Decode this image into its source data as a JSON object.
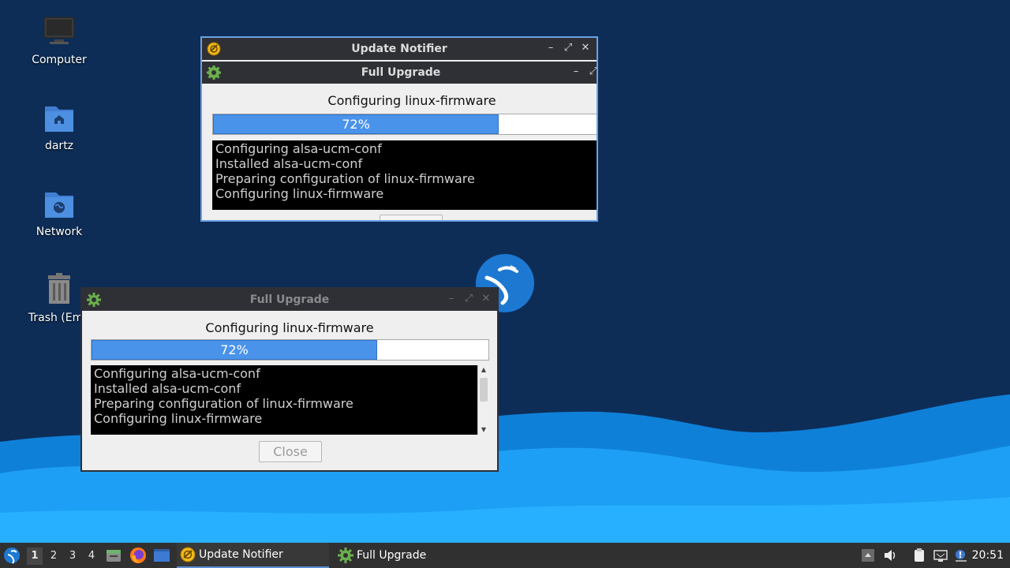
{
  "desktop": {
    "icons": [
      {
        "label": "Computer"
      },
      {
        "label": "dartz"
      },
      {
        "label": "Network"
      },
      {
        "label": "Trash (Emp"
      }
    ]
  },
  "update_notifier": {
    "title": "Update Notifier",
    "inner_title": "Full Upgrade",
    "status": "Configuring linux-firmware",
    "progress_percent": 72,
    "progress_label": "72%",
    "log": [
      "Configuring alsa-ucm-conf",
      "Installed alsa-ucm-conf",
      "Preparing configuration of linux-firmware",
      "Configuring linux-firmware"
    ]
  },
  "full_upgrade": {
    "title": "Full Upgrade",
    "status": "Configuring linux-firmware",
    "progress_percent": 72,
    "progress_label": "72%",
    "log": [
      "Configuring alsa-ucm-conf",
      "Installed alsa-ucm-conf",
      "Preparing configuration of linux-firmware",
      "Configuring linux-firmware"
    ],
    "close_label": "Close"
  },
  "taskbar": {
    "workspaces": [
      "1",
      "2",
      "3",
      "4"
    ],
    "current_workspace": "1",
    "tasks": [
      {
        "label": "Update Notifier",
        "icon": "update-notifier-icon",
        "active": true
      },
      {
        "label": "Full Upgrade",
        "icon": "gear-icon",
        "active": false
      }
    ],
    "clock": "20:51"
  },
  "colors": {
    "accent": "#4a93ea",
    "titlebar": "#2f3035",
    "taskbar": "#303030",
    "desktop_dark": "#0d2d57",
    "wave": "#1599f0"
  }
}
